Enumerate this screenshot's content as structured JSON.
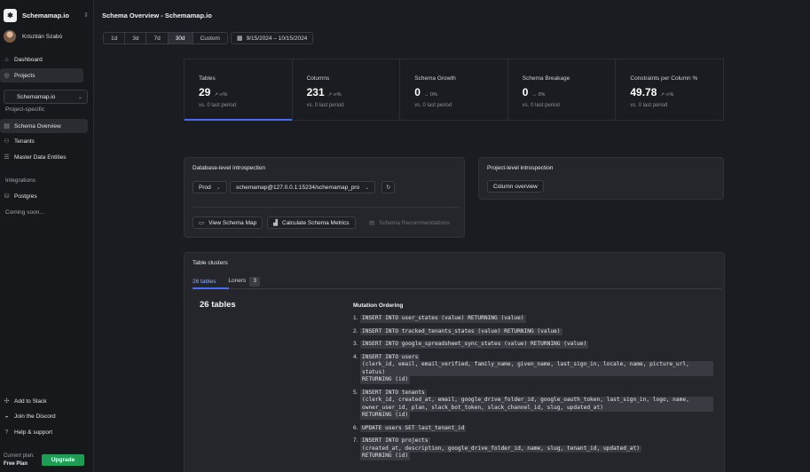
{
  "app": {
    "brand": "Schemamap.io",
    "user": "Krisztián Szabó"
  },
  "sidebar": {
    "nav_top": [
      {
        "label": "Dashboard",
        "icon": "home-icon"
      },
      {
        "label": "Projects",
        "icon": "projects-icon"
      }
    ],
    "project_select": "Schemamap.io",
    "project_section": "Project-specific",
    "nav_project": [
      {
        "label": "Schema Overview",
        "icon": "table-icon"
      },
      {
        "label": "Tenants",
        "icon": "users-icon"
      },
      {
        "label": "Master Data Entities",
        "icon": "list-icon"
      }
    ],
    "integrations_label": "Integrations",
    "postgres": "Postgres",
    "coming_soon": "Coming soon...",
    "bottom": [
      {
        "label": "Add to Slack",
        "icon": "slack-icon"
      },
      {
        "label": "Join the Discord",
        "icon": "discord-icon"
      },
      {
        "label": "Help & support",
        "icon": "help-icon"
      }
    ],
    "plan_label": "Current plan:",
    "plan_name": "Free Plan",
    "upgrade": "Upgrade"
  },
  "header": {
    "title": "Schema Overview - Schemamap.io",
    "ranges": [
      "1d",
      "3d",
      "7d",
      "30d",
      "Custom"
    ],
    "active_range": "30d",
    "date_range": "9/15/2024 – 10/15/2024"
  },
  "stats": [
    {
      "label": "Tables",
      "value": "29",
      "delta": "↗ ∞%",
      "sub": "vs. 0 last period"
    },
    {
      "label": "Columns",
      "value": "231",
      "delta": "↗ ∞%",
      "sub": "vs. 0 last period"
    },
    {
      "label": "Schema Growth",
      "value": "0",
      "delta": "→ 0%",
      "sub": "vs. 0 last period"
    },
    {
      "label": "Schema Breakage",
      "value": "0",
      "delta": "→ 0%",
      "sub": "vs. 0 last period"
    },
    {
      "label": "Constraints per Column %",
      "value": "49.78",
      "delta": "↗ ∞%",
      "sub": "vs. 0 last period"
    }
  ],
  "db_card": {
    "title": "Database-level introspection",
    "env": "Prod",
    "connection": "schemamap@127.0.0.1:15234/schemamap_pro",
    "actions": [
      "View Schema Map",
      "Calculate Schema Metrics",
      "Schema Recommendations"
    ]
  },
  "project_card": {
    "title": "Project-level introspection",
    "button": "Column overview"
  },
  "clusters": {
    "title": "Table clusters",
    "tabs": [
      {
        "label": "26 tables"
      },
      {
        "label": "Loners",
        "count": "3"
      }
    ],
    "heading": "26 tables",
    "mutation_title": "Mutation Ordering",
    "mutations": [
      {
        "n": "1.",
        "lines": [
          "INSERT INTO user_states (value) RETURNING (value)"
        ]
      },
      {
        "n": "2.",
        "lines": [
          "INSERT INTO tracked_tenants_states (value) RETURNING (value)"
        ]
      },
      {
        "n": "3.",
        "lines": [
          "INSERT INTO google_spreadsheet_sync_states (value) RETURNING (value)"
        ]
      },
      {
        "n": "4.",
        "lines": [
          "INSERT INTO users",
          "(clerk_id, email, email_verified, family_name, given_name, last_sign_in, locale, name, picture_url, status)",
          "RETURNING (id)"
        ]
      },
      {
        "n": "5.",
        "lines": [
          "INSERT INTO tenants",
          "(clerk_id, created_at, email, google_drive_folder_id, google_oauth_token, last_sign_in, logo, name, owner_user_id, plan, slack_bot_token, slack_channel_id, slug, updated_at)",
          "RETURNING (id)"
        ]
      },
      {
        "n": "6.",
        "lines": [
          "UPDATE users SET last_tenant_id"
        ]
      },
      {
        "n": "7.",
        "lines": [
          "INSERT INTO projects",
          "(created_at, description, google_drive_folder_id, name, slug, tenant_id, updated_at)",
          "RETURNING (id)"
        ]
      }
    ]
  }
}
